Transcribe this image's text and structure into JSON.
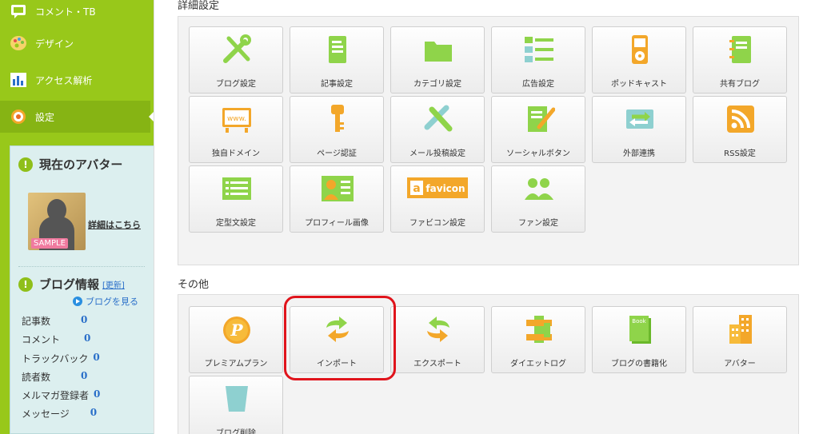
{
  "sidebar": {
    "nav": [
      {
        "label": "コメント・TB",
        "icon": "comment-icon"
      },
      {
        "label": "デザイン",
        "icon": "palette-icon"
      },
      {
        "label": "アクセス解析",
        "icon": "bar-chart-icon"
      },
      {
        "label": "設定",
        "icon": "gear-icon"
      }
    ],
    "avatar_section": {
      "title": "現在のアバター",
      "detail_link": "詳細はこちら",
      "sample_tag": "SAMPLE"
    },
    "blog_info": {
      "title": "ブログ情報",
      "update_link": "[更新]",
      "view_blog_link": "ブログを見る",
      "stats": [
        {
          "label": "記事数",
          "value": "0"
        },
        {
          "label": "コメント",
          "value": "0"
        },
        {
          "label": "トラックバック",
          "value": "0"
        },
        {
          "label": "読者数",
          "value": "0"
        },
        {
          "label": "メルマガ登録者",
          "value": "0"
        },
        {
          "label": "メッセージ",
          "value": "0"
        }
      ]
    }
  },
  "main": {
    "detail_section": {
      "title": "詳細設定",
      "tiles": [
        {
          "label": "ブログ設定",
          "icon": "tools-icon"
        },
        {
          "label": "記事設定",
          "icon": "document-icon"
        },
        {
          "label": "カテゴリ設定",
          "icon": "folder-icon"
        },
        {
          "label": "広告設定",
          "icon": "list-icon"
        },
        {
          "label": "ポッドキャスト",
          "icon": "ipod-icon"
        },
        {
          "label": "共有ブログ",
          "icon": "notebook-icon"
        },
        {
          "label": "独自ドメイン",
          "icon": "www-sign-icon",
          "icon_text": "www."
        },
        {
          "label": "ページ認証",
          "icon": "key-icon"
        },
        {
          "label": "メール投稿設定",
          "icon": "pencil-tool-icon"
        },
        {
          "label": "ソーシャルボタン",
          "icon": "edit-document-icon"
        },
        {
          "label": "外部連携",
          "icon": "sync-arrows-icon"
        },
        {
          "label": "RSS設定",
          "icon": "rss-icon"
        },
        {
          "label": "定型文設定",
          "icon": "template-icon"
        },
        {
          "label": "プロフィール画像",
          "icon": "profile-card-icon"
        },
        {
          "label": "ファビコン設定",
          "icon": "favicon-icon",
          "icon_text": "favicon"
        },
        {
          "label": "ファン設定",
          "icon": "fans-icon"
        }
      ]
    },
    "other_section": {
      "title": "その他",
      "tiles": [
        {
          "label": "プレミアムプラン",
          "icon": "premium-coin-icon",
          "icon_text": "P"
        },
        {
          "label": "インポート",
          "icon": "import-arrows-icon"
        },
        {
          "label": "エクスポート",
          "icon": "export-arrows-icon"
        },
        {
          "label": "ダイエットログ",
          "icon": "measure-icon"
        },
        {
          "label": "ブログの書籍化",
          "icon": "book-icon",
          "icon_text": "Book"
        },
        {
          "label": "アバター",
          "icon": "building-icon"
        },
        {
          "label": "ブログ削除",
          "icon": "trash-icon"
        }
      ]
    }
  },
  "colors": {
    "sidebar_green": "#98c81a",
    "icon_green": "#8fd44a",
    "highlight_red": "#e0141c",
    "link_blue": "#2a6fc9"
  }
}
